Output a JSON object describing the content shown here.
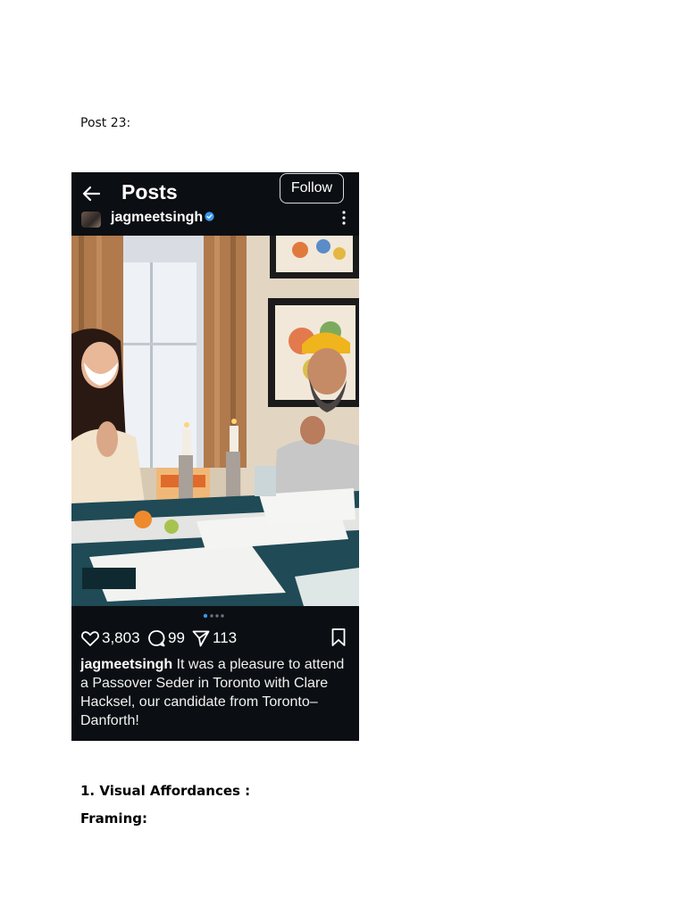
{
  "document": {
    "post_label": "Post 23:",
    "heading_1": "1. Visual Affordances :",
    "heading_2": "Framing:"
  },
  "post": {
    "header_title": "Posts",
    "follow_label": "Follow",
    "username": "jagmeetsingh",
    "carousel_total": 4,
    "carousel_active": 1,
    "likes": "3,803",
    "comments": "99",
    "shares": "113",
    "caption_user": "jagmeetsingh",
    "caption_text": " It was a pleasure to attend a Passover Seder in Toronto with Clare Hacksel, our candidate from Toronto–Danforth!"
  },
  "icons": {
    "back": "arrow-left-icon",
    "verified": "verified-badge-icon",
    "more": "vertical-dots-icon",
    "like": "heart-icon",
    "comment": "comment-bubble-icon",
    "share": "paper-plane-icon",
    "save": "bookmark-icon"
  },
  "colors": {
    "app_background": "#0b0e12",
    "verified_blue": "#3897f0",
    "active_dot": "#3897f0",
    "inactive_dot": "#6b7280"
  }
}
